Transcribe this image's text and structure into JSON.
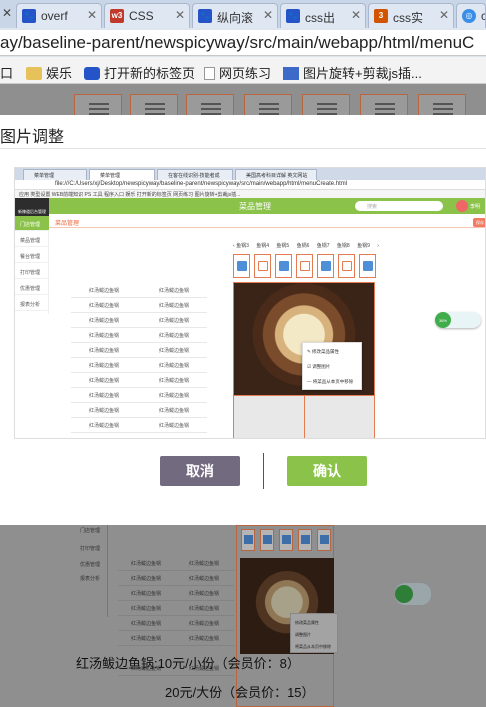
{
  "browser": {
    "tabs": [
      {
        "icon_text": "",
        "label": "overf"
      },
      {
        "icon_text": "w3",
        "label": "CSS"
      },
      {
        "icon_text": "",
        "label": "纵向滚"
      },
      {
        "icon_text": "",
        "label": "css出"
      },
      {
        "icon_text": "",
        "label": "css实"
      },
      {
        "icon_text": "",
        "label": "c"
      }
    ],
    "address": "ay/baseline-parent/newspicyway/src/main/webapp/html/menuC",
    "bookmarks": [
      "口",
      "娱乐",
      "打开新的标签页",
      "网页练习",
      "图片旋转+剪裁js插..."
    ]
  },
  "modal": {
    "title": "图片调整",
    "cancel_label": "取消",
    "confirm_label": "确认"
  },
  "embedded": {
    "tabs": [
      "菜单管理",
      "菜单管理",
      "在客在线识别-技能者成",
      "美国高考科目详解 英文网站"
    ],
    "address": "file:///C:/Users/xj/Desktop/newspicyway/baseline-parent/newspicyway/src/main/webapp/html/menuCreate.html",
    "bookmarks": "应用  类型设置  WEB前端知识  PS  工具  程序入口  娱乐  打开新的标签页  网页练习  图片旋转+剪裁js插...",
    "header_title": "菜品管理",
    "search_placeholder": "搜索",
    "user_name": "李明",
    "logo_text": "新辣道后台管理",
    "side_items": [
      "门店管理",
      "菜品管理",
      "餐台管理",
      "打印管理",
      "优惠管理",
      "报表分析"
    ],
    "crumb": "菜品管理",
    "crumb_button": "保存",
    "categories": [
      "鱼锅3",
      "鱼锅4",
      "鱼锅5",
      "鱼锅6",
      "鱼锅7",
      "鱼锅8",
      "鱼锅9"
    ],
    "table_cell": "红汤鲅边鱼锅",
    "context_menu": [
      "修改菜品属性",
      "调整图片",
      "将菜品从本页中移除"
    ],
    "widget_percent": "36%"
  },
  "background": {
    "side_items": [
      "门店管理",
      "打印管理",
      "优惠管理",
      "报表分析"
    ],
    "context_menu": [
      "修改菜品属性",
      "调整图片",
      "将菜品从本页中移除"
    ],
    "price_line1": "红汤鲅边鱼锅:10元/小份（会员价：8）",
    "price_line2": "20元/大份（会员价：15）"
  }
}
